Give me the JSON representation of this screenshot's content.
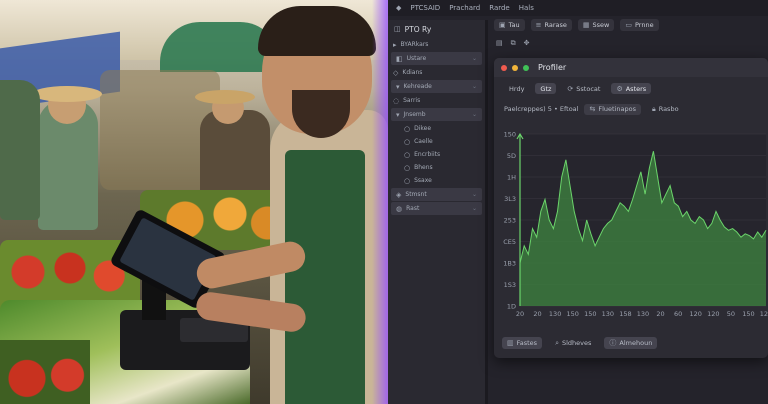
{
  "menubar": {
    "items": [
      "PTCSAID",
      "Prachard",
      "Rarde",
      "Hals"
    ]
  },
  "toolbar": {
    "buttons": [
      {
        "icon": "frame-icon",
        "label": "Tau"
      },
      {
        "icon": "list-icon",
        "label": "Rarase"
      },
      {
        "icon": "grid-icon",
        "label": "Ssew"
      },
      {
        "icon": "window-icon",
        "label": "Prnne"
      }
    ]
  },
  "sidebar": {
    "title": "PTO Ry",
    "items": [
      {
        "label": "BYARkars",
        "kind": "item"
      },
      {
        "label": "Ustare",
        "kind": "hl"
      },
      {
        "label": "Kdians",
        "kind": "item"
      },
      {
        "label": "Kehreade",
        "kind": "hl"
      },
      {
        "label": "Sarris",
        "kind": "item"
      },
      {
        "label": "Jnsemb",
        "kind": "hl"
      },
      {
        "label": "Dikee",
        "kind": "sub"
      },
      {
        "label": "Caelle",
        "kind": "sub"
      },
      {
        "label": "Encrbiits",
        "kind": "sub"
      },
      {
        "label": "Bhens",
        "kind": "sub"
      },
      {
        "label": "Ssaxe",
        "kind": "sub"
      },
      {
        "label": "Stmsnt",
        "kind": "hl"
      },
      {
        "label": "Rast",
        "kind": "hl"
      }
    ]
  },
  "profiler": {
    "title": "Profiler",
    "tabs": [
      {
        "label": "Hrdy",
        "icon": ""
      },
      {
        "label": "Gtz",
        "icon": ""
      },
      {
        "label": "Sstocat",
        "icon": "refresh-icon"
      },
      {
        "label": "Asters",
        "icon": "gear-icon"
      }
    ],
    "subbar": [
      "Paelcreppes) 5 • Eftoal",
      "Fluetinapos",
      "Rasbo"
    ],
    "footer": [
      {
        "label": "Fastes",
        "icon": "chart-icon"
      },
      {
        "label": "Sldheves",
        "icon": "search-icon"
      },
      {
        "label": "Almehoun",
        "icon": "info-icon"
      }
    ]
  },
  "chart_data": {
    "type": "area",
    "y_ticks": [
      "150",
      "5D",
      "1H",
      "3L3",
      "253",
      "CE5",
      "1B3",
      "1S3",
      "1D"
    ],
    "x_ticks": [
      "20",
      "20",
      "130",
      "150",
      "150",
      "130",
      "158",
      "130",
      "20",
      "60",
      "120",
      "120",
      "50",
      "150",
      "120"
    ],
    "x": [
      0,
      1,
      2,
      3,
      4,
      5,
      6,
      7,
      8,
      9,
      10,
      11,
      12,
      13,
      14,
      15,
      16,
      17,
      18,
      19,
      20,
      21,
      22,
      23,
      24,
      25,
      26,
      27,
      28,
      29,
      30,
      31,
      32,
      33,
      34,
      35,
      36,
      37,
      38,
      39,
      40,
      41,
      42,
      43,
      44,
      45,
      46,
      47,
      48,
      49,
      50,
      51,
      52,
      53,
      54,
      55,
      56,
      57,
      58,
      59
    ],
    "values": [
      0.25,
      0.35,
      0.3,
      0.45,
      0.4,
      0.55,
      0.62,
      0.5,
      0.45,
      0.55,
      0.75,
      0.85,
      0.7,
      0.55,
      0.45,
      0.38,
      0.5,
      0.42,
      0.35,
      0.4,
      0.45,
      0.48,
      0.5,
      0.55,
      0.6,
      0.58,
      0.55,
      0.62,
      0.7,
      0.78,
      0.65,
      0.8,
      0.9,
      0.75,
      0.6,
      0.65,
      0.7,
      0.6,
      0.58,
      0.52,
      0.55,
      0.5,
      0.48,
      0.52,
      0.5,
      0.45,
      0.48,
      0.55,
      0.5,
      0.46,
      0.44,
      0.45,
      0.43,
      0.4,
      0.42,
      0.41,
      0.39,
      0.43,
      0.4,
      0.44
    ],
    "ylim": [
      0,
      1
    ],
    "colors": {
      "fill": "#3c7a3e",
      "line": "#6bd46b",
      "bg": "#26252d",
      "grid": "#3a3942"
    }
  }
}
